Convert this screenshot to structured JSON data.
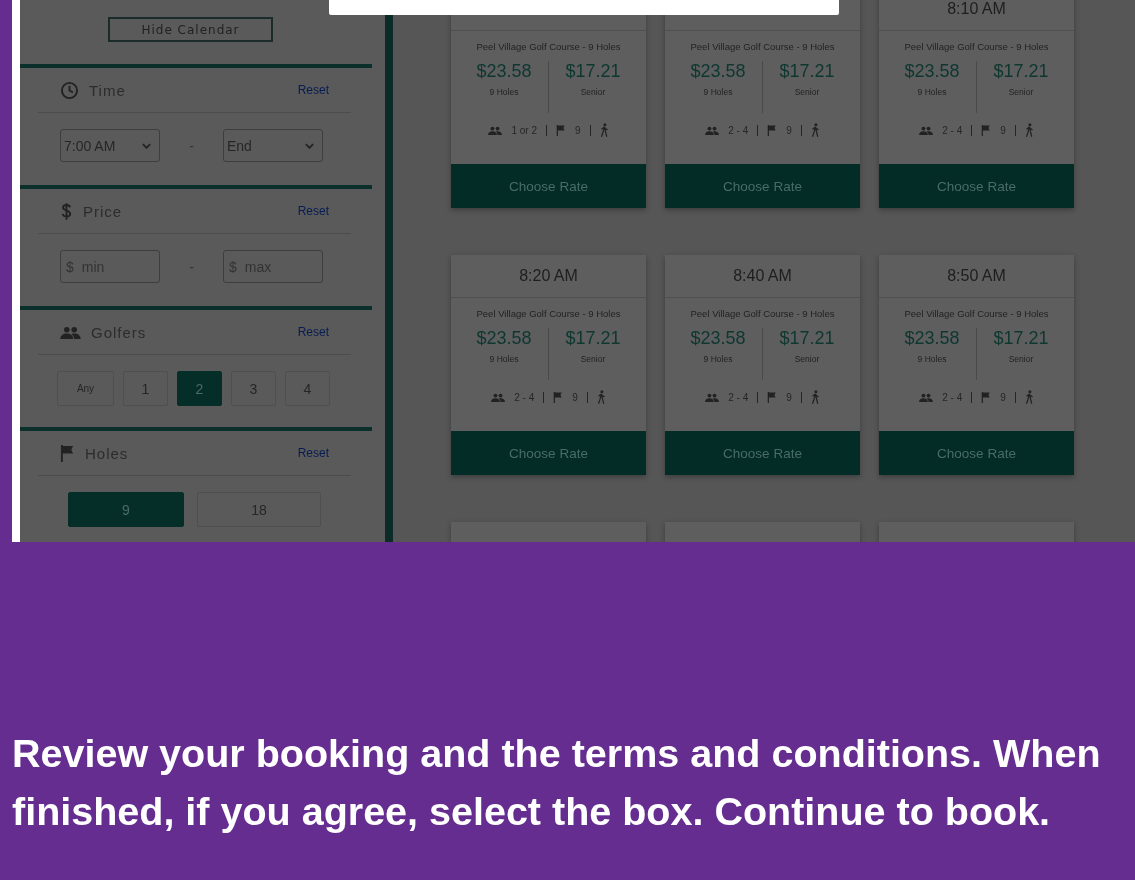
{
  "sidebar": {
    "hide_calendar_button": "Hide Calendar",
    "sections": [
      {
        "kind": "time",
        "title": "Time",
        "reset": "Reset",
        "from": "7:00 AM",
        "separator": "-",
        "to": "End"
      },
      {
        "kind": "price",
        "title": "Price",
        "reset": "Reset",
        "min": {
          "prefix": "$",
          "placeholder": "min"
        },
        "separator": "-",
        "max": {
          "prefix": "$",
          "placeholder": "max"
        }
      },
      {
        "kind": "golfers",
        "title": "Golfers",
        "reset": "Reset",
        "options": [
          {
            "label": "Any",
            "selected": false
          },
          {
            "label": "1",
            "selected": false
          },
          {
            "label": "2",
            "selected": true
          },
          {
            "label": "3",
            "selected": false
          },
          {
            "label": "4",
            "selected": false
          }
        ]
      },
      {
        "kind": "holes",
        "title": "Holes",
        "reset": "Reset",
        "options": [
          {
            "label": "9",
            "selected": true
          },
          {
            "label": "18",
            "selected": false
          }
        ]
      }
    ]
  },
  "tee_times": [
    {
      "course": "Peel Village Golf Course - 9 Holes",
      "prices": [
        {
          "amount": "$23.58",
          "label": "9 Holes"
        },
        {
          "amount": "$17.21",
          "label": "Senior"
        }
      ],
      "players": "1 or 2",
      "holes": "9",
      "button": "Choose Rate"
    },
    {
      "course": "Peel Village Golf Course - 9 Holes",
      "prices": [
        {
          "amount": "$23.58",
          "label": "9 Holes"
        },
        {
          "amount": "$17.21",
          "label": "Senior"
        }
      ],
      "players": "2 - 4",
      "holes": "9",
      "button": "Choose Rate"
    },
    {
      "time": "8:10 AM",
      "course": "Peel Village Golf Course - 9 Holes",
      "prices": [
        {
          "amount": "$23.58",
          "label": "9 Holes"
        },
        {
          "amount": "$17.21",
          "label": "Senior"
        }
      ],
      "players": "2 - 4",
      "holes": "9",
      "button": "Choose Rate"
    },
    {
      "time": "8:20 AM",
      "course": "Peel Village Golf Course - 9 Holes",
      "prices": [
        {
          "amount": "$23.58",
          "label": "9 Holes"
        },
        {
          "amount": "$17.21",
          "label": "Senior"
        }
      ],
      "players": "2 - 4",
      "holes": "9",
      "button": "Choose Rate"
    },
    {
      "time": "8:40 AM",
      "course": "Peel Village Golf Course - 9 Holes",
      "prices": [
        {
          "amount": "$23.58",
          "label": "9 Holes"
        },
        {
          "amount": "$17.21",
          "label": "Senior"
        }
      ],
      "players": "2 - 4",
      "holes": "9",
      "button": "Choose Rate"
    },
    {
      "time": "8:50 AM",
      "course": "Peel Village Golf Course - 9 Holes",
      "prices": [
        {
          "amount": "$23.58",
          "label": "9 Holes"
        },
        {
          "amount": "$17.21",
          "label": "Senior"
        }
      ],
      "players": "2 - 4",
      "holes": "9",
      "button": "Choose Rate"
    },
    {
      "kind": "cut_off"
    },
    {
      "kind": "cut_off"
    },
    {
      "kind": "cut_off"
    }
  ],
  "caption": "Review your booking and the terms and conditions. When finished, if you agree, select the box. Continue to book."
}
